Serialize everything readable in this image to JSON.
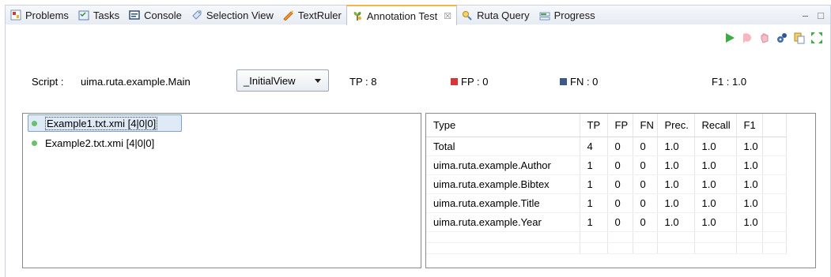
{
  "tabs": [
    {
      "label": "Problems",
      "icon": "problems-icon"
    },
    {
      "label": "Tasks",
      "icon": "tasks-icon"
    },
    {
      "label": "Console",
      "icon": "console-icon"
    },
    {
      "label": "Selection View",
      "icon": "selection-view-icon"
    },
    {
      "label": "TextRuler",
      "icon": "textruler-icon"
    },
    {
      "label": "Annotation Test",
      "icon": "annotation-test-icon",
      "active": true,
      "close": "☒"
    },
    {
      "label": "Ruta Query",
      "icon": "ruta-query-icon"
    },
    {
      "label": "Progress",
      "icon": "progress-icon"
    }
  ],
  "window_controls": {
    "minimize": "–",
    "maximize": "□"
  },
  "toolbar_icons": [
    "run-test-icon",
    "exclude-icon",
    "clear-icon",
    "settings-icon",
    "export-icon",
    "expand-icon"
  ],
  "summary": {
    "script_label": "Script :",
    "script_value": "uima.ruta.example.Main",
    "view_selected": "_InitialView",
    "tp": "TP :  8",
    "fp": "FP :  0",
    "fn": "FN :  0",
    "f1": "F1 :  1.0"
  },
  "files": [
    {
      "label": "Example1.txt.xmi [4|0|0]",
      "selected": true
    },
    {
      "label": "Example2.txt.xmi [4|0|0]",
      "selected": false
    }
  ],
  "table": {
    "columns": [
      "Type",
      "TP",
      "FP",
      "FN",
      "Prec.",
      "Recall",
      "F1",
      ""
    ],
    "rows": [
      [
        "Total",
        "4",
        "0",
        "0",
        "1.0",
        "1.0",
        "1.0",
        ""
      ],
      [
        "uima.ruta.example.Author",
        "1",
        "0",
        "0",
        "1.0",
        "1.0",
        "1.0",
        ""
      ],
      [
        "uima.ruta.example.Bibtex",
        "1",
        "0",
        "0",
        "1.0",
        "1.0",
        "1.0",
        ""
      ],
      [
        "uima.ruta.example.Title",
        "1",
        "0",
        "0",
        "1.0",
        "1.0",
        "1.0",
        ""
      ],
      [
        "uima.ruta.example.Year",
        "1",
        "0",
        "0",
        "1.0",
        "1.0",
        "1.0",
        ""
      ]
    ]
  },
  "colors": {
    "fp_marker": "#d4363b",
    "fn_marker": "#3c5a86",
    "active_tab_accent": "#f3b84a",
    "status_dot": "#6cc06c"
  }
}
